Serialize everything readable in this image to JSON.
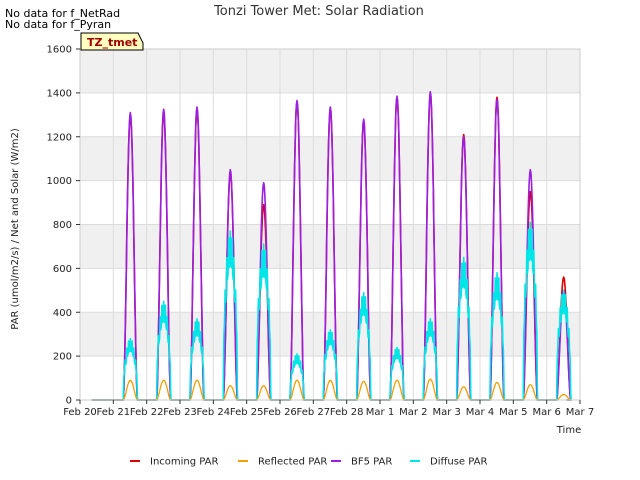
{
  "nodata": [
    "No data for f_NetRad",
    "No data for f_Pyran"
  ],
  "badge": "TZ_tmet",
  "chart_data": {
    "type": "line",
    "title": "Tonzi Tower Met: Solar Radiation",
    "xlabel": "Time",
    "ylabel": "PAR (umol/m2/s) / Net and Solar (W/m2)",
    "ylim": [
      0,
      1600
    ],
    "yticks": [
      0,
      200,
      400,
      600,
      800,
      1000,
      1200,
      1400,
      1600
    ],
    "xlim": [
      0,
      15
    ],
    "xticks": [
      "Feb 20",
      "Feb 21",
      "Feb 22",
      "Feb 23",
      "Feb 24",
      "Feb 25",
      "Feb 26",
      "Feb 27",
      "Feb 28",
      "Mar 1",
      "Mar 2",
      "Mar 3",
      "Mar 4",
      "Mar 5",
      "Mar 6",
      "Mar 7"
    ],
    "grid": true,
    "legend_position": "bottom",
    "series": [
      {
        "name": "Incoming PAR",
        "color": "#dd0000",
        "days": [
          1,
          2,
          3,
          4,
          5,
          6,
          7,
          8,
          9,
          10,
          11,
          12,
          13,
          14
        ],
        "peaks": [
          1300,
          1310,
          1320,
          1040,
          890,
          1360,
          1330,
          1270,
          1380,
          1400,
          1210,
          1380,
          950,
          560
        ]
      },
      {
        "name": "Reflected PAR",
        "color": "#f0a000",
        "days": [
          1,
          2,
          3,
          4,
          5,
          6,
          7,
          8,
          9,
          10,
          11,
          12,
          13,
          14
        ],
        "peaks": [
          90,
          90,
          90,
          65,
          65,
          90,
          90,
          85,
          90,
          95,
          60,
          80,
          70,
          25
        ]
      },
      {
        "name": "BF5 PAR",
        "color": "#9b1fe0",
        "days": [
          1,
          2,
          3,
          4,
          5,
          6,
          7,
          8,
          9,
          10,
          11,
          12,
          13,
          14
        ],
        "peaks": [
          1310,
          1325,
          1335,
          1050,
          990,
          1365,
          1335,
          1280,
          1385,
          1405,
          1200,
          1370,
          1050,
          500
        ]
      },
      {
        "name": "Diffuse PAR",
        "color": "#00e5e5",
        "days": [
          1,
          2,
          3,
          4,
          5,
          6,
          7,
          8,
          9,
          10,
          11,
          12,
          13,
          14
        ],
        "peaks": [
          280,
          450,
          370,
          770,
          710,
          210,
          320,
          490,
          240,
          370,
          650,
          580,
          810,
          500
        ]
      }
    ]
  }
}
